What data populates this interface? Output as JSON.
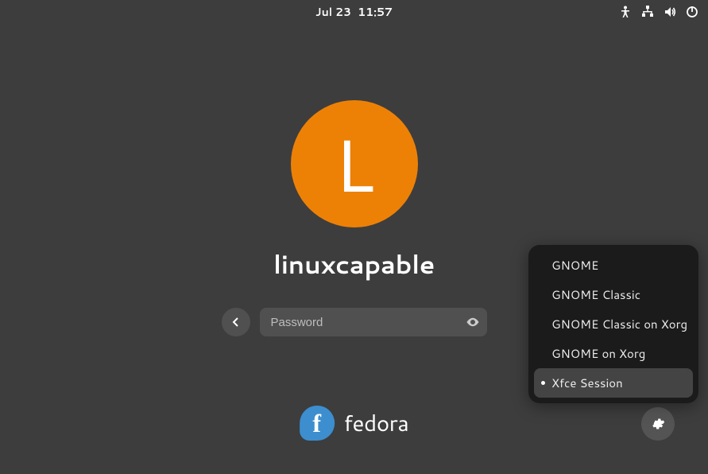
{
  "topbar": {
    "date": "Jul 23",
    "time": "11:57"
  },
  "login": {
    "avatar_initial": "L",
    "avatar_bg": "#ed8106",
    "username": "linuxcapable",
    "password_placeholder": "Password"
  },
  "session_menu": {
    "items": [
      {
        "label": "GNOME",
        "selected": false
      },
      {
        "label": "GNOME Classic",
        "selected": false
      },
      {
        "label": "GNOME Classic on Xorg",
        "selected": false
      },
      {
        "label": "GNOME on Xorg",
        "selected": false
      },
      {
        "label": "Xfce Session",
        "selected": true
      }
    ]
  },
  "branding": {
    "distro_name": "fedora"
  }
}
